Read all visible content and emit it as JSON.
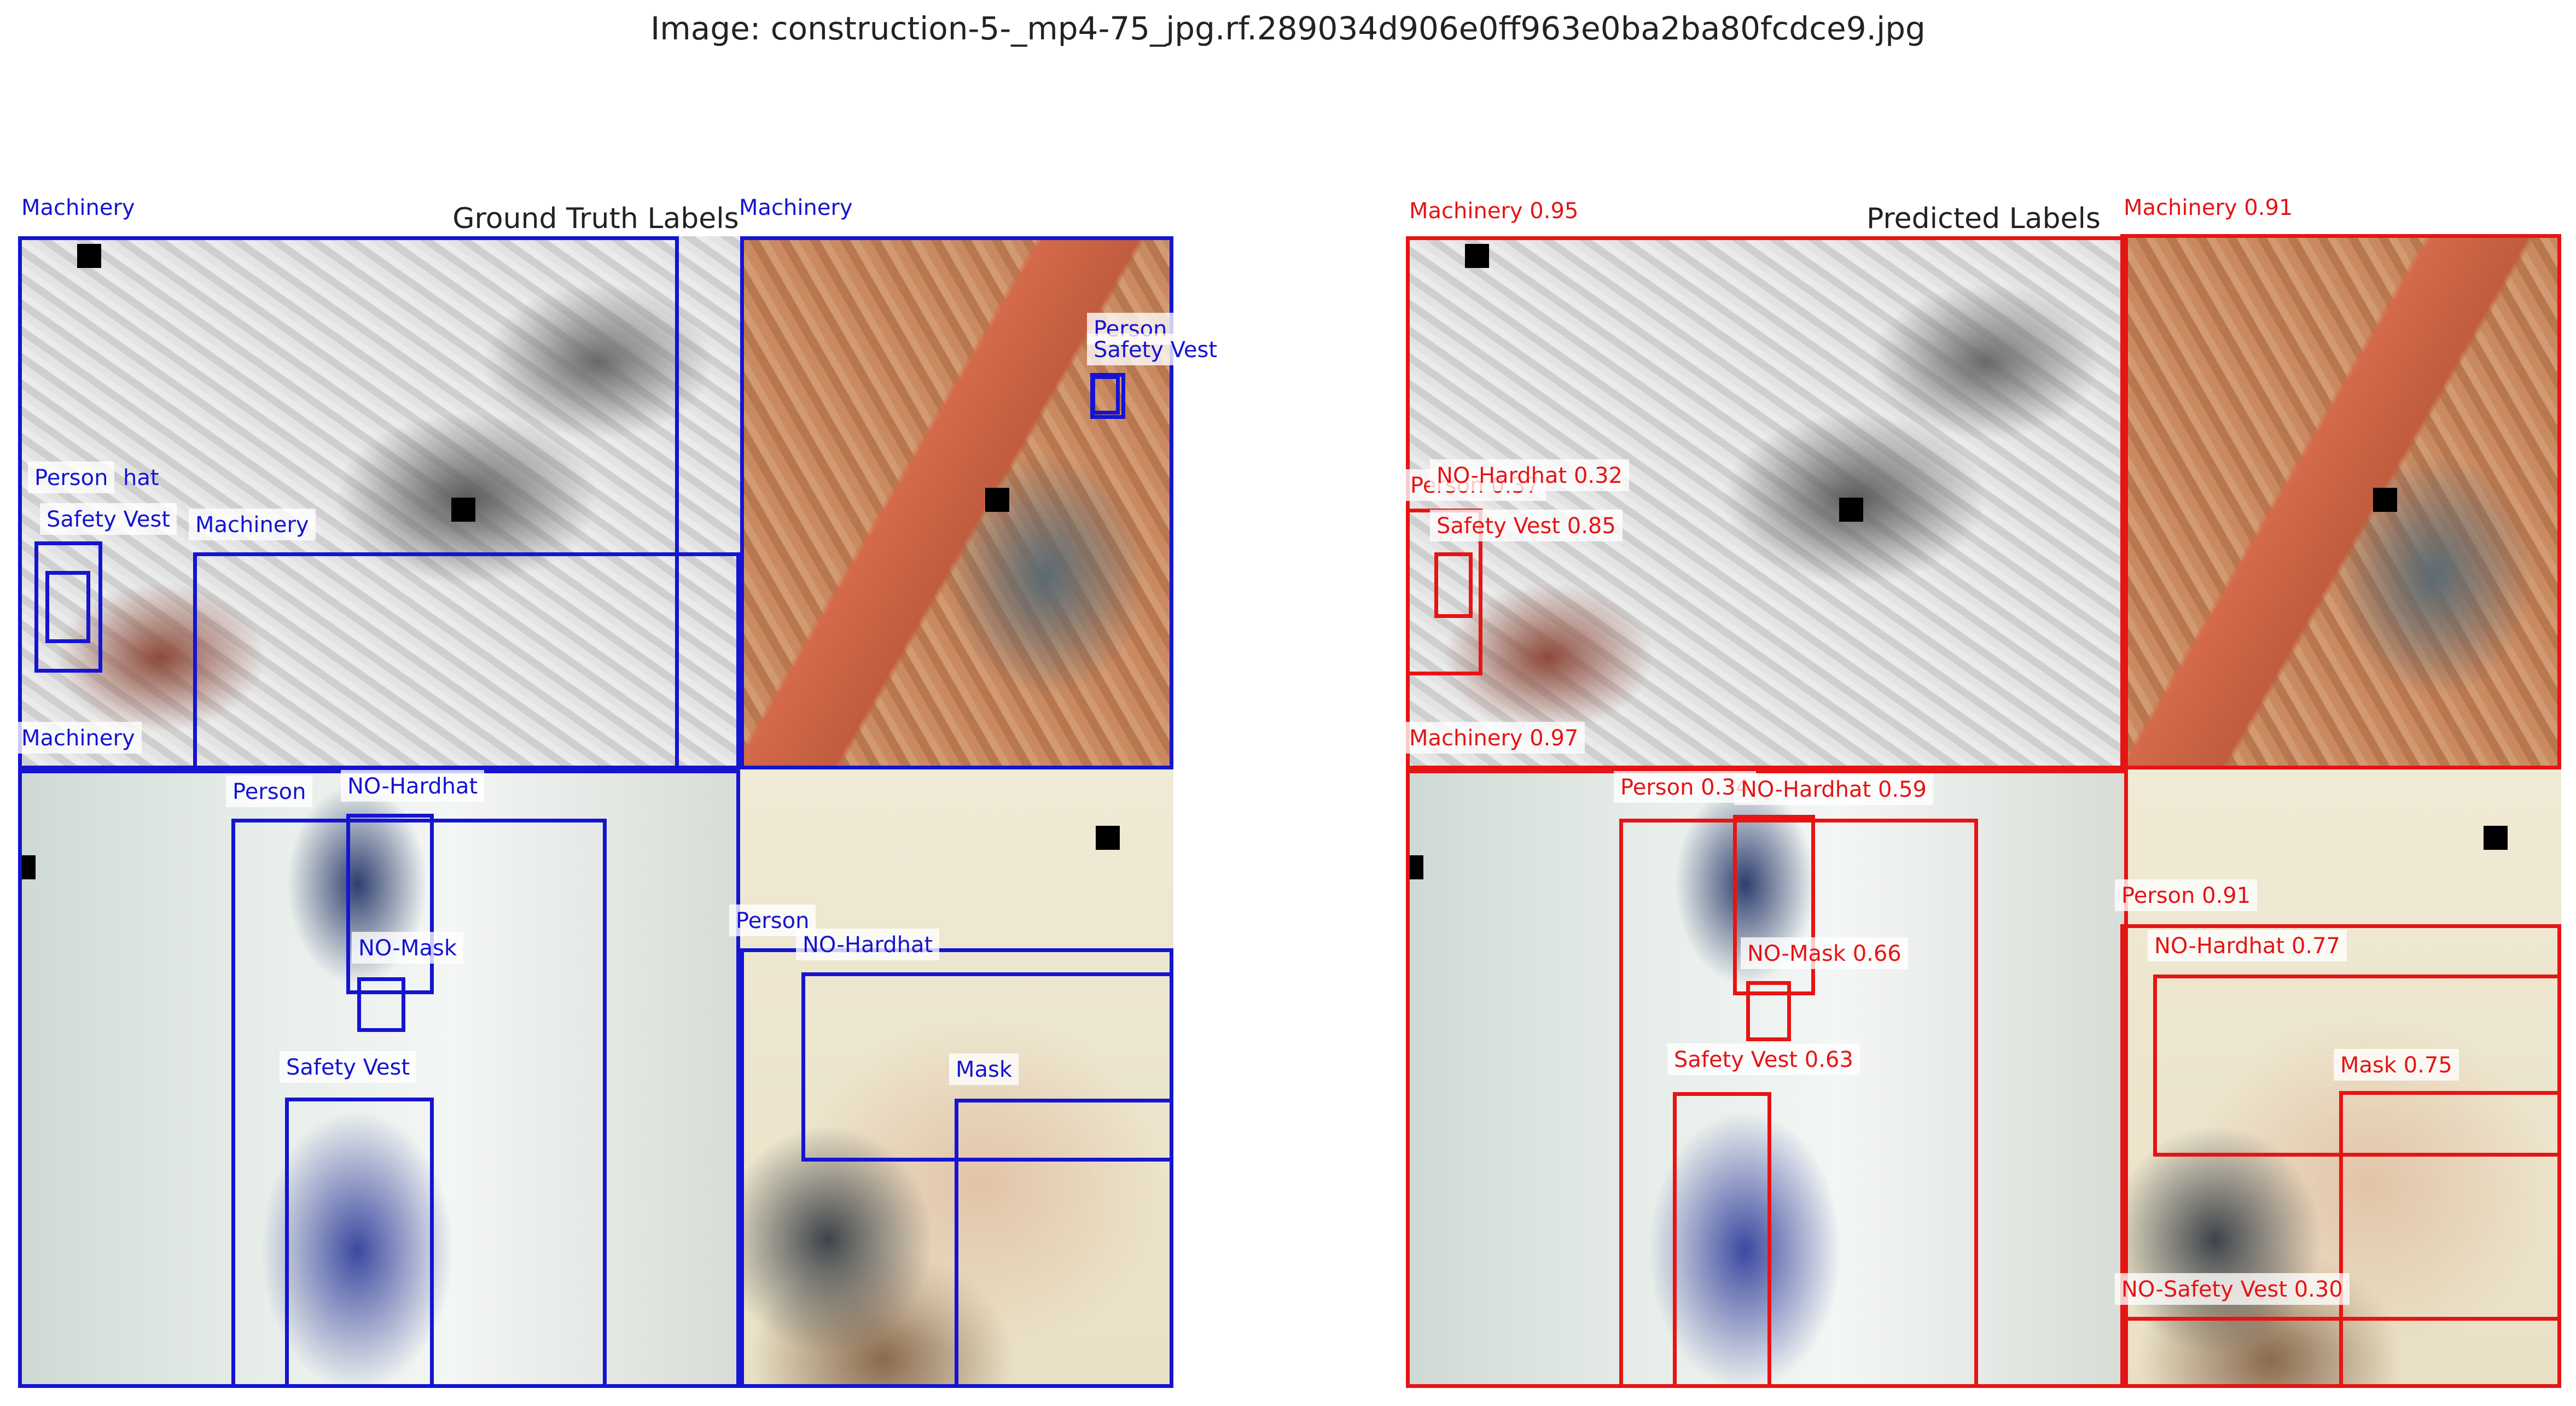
{
  "figure_title": "Image: construction-5-_mp4-75_jpg.rf.289034d906e0ff963e0ba2ba80fcdce9.jpg",
  "colors": {
    "ground_truth": "#1414d2",
    "predicted": "#e61414"
  },
  "ground_truth": {
    "title": "Ground Truth Labels",
    "labels": {
      "machinery_a": "Machinery",
      "machinery_b": "Machinery",
      "machinery_c": "Machinery",
      "machinery_d": "Machinery",
      "person_a": "Person",
      "person_a_hardhat": "hat",
      "safety_vest_a": "Safety Vest",
      "person_b": "Person",
      "safety_vest_b": "Safety Vest",
      "person_c": "Person",
      "no_hardhat_c": "NO-Hardhat",
      "no_mask_c": "NO-Mask",
      "safety_vest_c": "Safety Vest",
      "person_d": "Person",
      "no_hardhat_d": "NO-Hardhat",
      "mask_d": "Mask"
    }
  },
  "predicted": {
    "title": "Predicted Labels",
    "labels": {
      "machinery_a": "Machinery 0.95",
      "machinery_b": "Machinery 0.91",
      "machinery_c": "Machinery 0.97",
      "person_a": "Person 0.37",
      "no_hardhat_a": "NO-Hardhat 0.32",
      "safety_vest_a": "Safety Vest 0.85",
      "person_c": "Person 0.34",
      "no_hardhat_c": "NO-Hardhat 0.59",
      "no_mask_c": "NO-Mask 0.66",
      "safety_vest_c": "Safety Vest 0.63",
      "person_d": "Person 0.91",
      "no_hardhat_d": "NO-Hardhat 0.77",
      "mask_d": "Mask 0.75",
      "no_safety_vest_d": "NO-Safety Vest 0.30"
    }
  }
}
